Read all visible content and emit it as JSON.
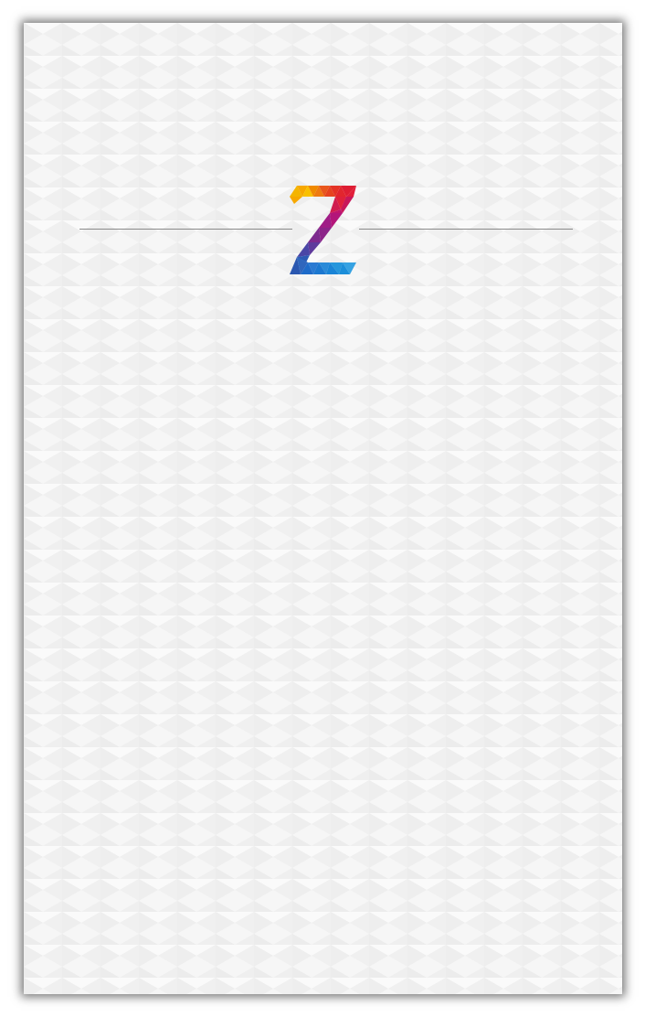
{
  "screen": {
    "background_color": "#ffffff",
    "card_color": "#f4f4f4"
  },
  "logo": {
    "letter": "Z",
    "icon": "z-logo-icon",
    "colors": [
      "#f7a800",
      "#e9561c",
      "#e21f3a",
      "#c0156e",
      "#7d2a8e",
      "#2d5bb4",
      "#1c8ed9"
    ]
  },
  "divider_color": "#8a8a8a"
}
